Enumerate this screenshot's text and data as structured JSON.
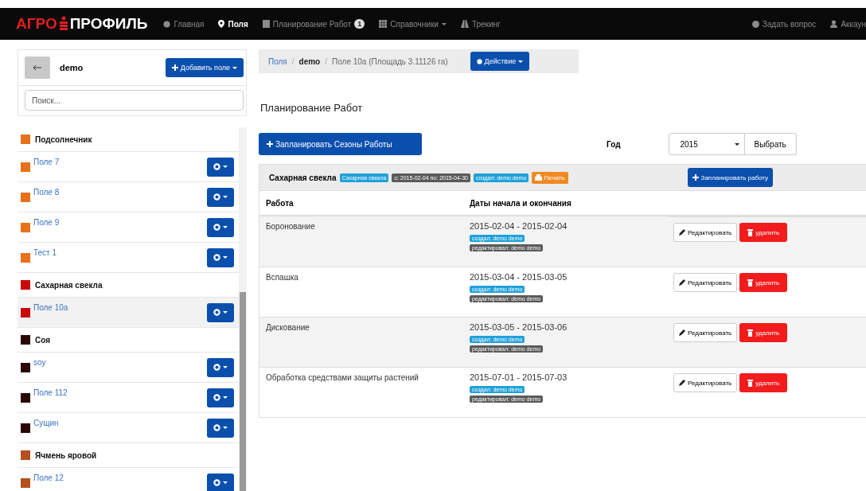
{
  "navbar": {
    "logo": {
      "part_1": "АГРО",
      "part_2": "ПРОФИЛЬ"
    },
    "items": [
      {
        "label": "Главная",
        "selected": false,
        "dropdown": false
      },
      {
        "label": "Поля",
        "selected": true,
        "dropdown": false
      },
      {
        "label": "Планирование Работ",
        "selected": false,
        "dropdown": false,
        "badge": "1"
      },
      {
        "label": "Справочники",
        "selected": false,
        "dropdown": true
      },
      {
        "label": "Трекинг",
        "selected": false,
        "dropdown": false
      }
    ],
    "right_items": [
      {
        "label": "Задать вопрос"
      },
      {
        "label": "Аккаун"
      }
    ]
  },
  "sidebar": {
    "farm": "demo",
    "add_button": "Добавить поле",
    "search": {
      "placeholder": "Поиск..."
    },
    "groups": [
      {
        "name": "Подсолнечник",
        "color": "#e8711c",
        "children": [
          {
            "name": "Поле 7",
            "selected": false
          },
          {
            "name": "Поле 8",
            "selected": false
          },
          {
            "name": "Поле 9",
            "selected": false
          },
          {
            "name": "Тест 1",
            "selected": false
          }
        ]
      },
      {
        "name": "Сахарная свекла",
        "color": "#c80a0a",
        "children": [
          {
            "name": "Поле 10а",
            "selected": true
          }
        ]
      },
      {
        "name": "Соя",
        "color": "#2a0808",
        "children": [
          {
            "name": "soy",
            "selected": false
          },
          {
            "name": "Поле 112",
            "selected": false
          },
          {
            "name": "Сущин",
            "selected": false
          }
        ]
      },
      {
        "name": "Ячмень яровой",
        "color": "#b4501e",
        "children": [
          {
            "name": "Поле 12",
            "selected": false
          }
        ]
      }
    ]
  },
  "breadcrumb": {
    "items": [
      {
        "label": "Поля",
        "kind": "link"
      },
      {
        "label": "demo",
        "kind": "bold"
      },
      {
        "label": "Поле 10а (Площадь 3.11126 га)",
        "kind": "plain"
      }
    ],
    "separator": "/",
    "action_button": "Действие"
  },
  "page_title": "Планирование Работ",
  "toolbar": {
    "plan_seasons_button": "Запланировать Сезоны Работы",
    "year_label": "Год",
    "year_value": "2015",
    "select_button": "Выбрать"
  },
  "panel": {
    "title": "Сахарная свекла",
    "labels": [
      {
        "text": "Сахарная свекла",
        "kind": "info"
      },
      {
        "text": "с: 2015-02-04 по: 2015-04-30",
        "kind": "default"
      },
      {
        "text": "создал: demo demo",
        "kind": "info"
      },
      {
        "text": "Печать",
        "kind": "warning"
      }
    ],
    "plan_button": "Запланировать работу",
    "table": {
      "columns": [
        "Работа",
        "Даты начала и окончания"
      ],
      "rows": [
        {
          "work": "Боронование",
          "dates": "2015-02-04 - 2015-02-04",
          "created": "создал: demo demo",
          "edited": "редактировал: demo demo",
          "edit": "Редактировать",
          "delete": "удалить"
        },
        {
          "work": "Вспашка",
          "dates": "2015-03-04 - 2015-03-05",
          "created": "создал: demo demo",
          "edited": "редактировал: demo demo",
          "edit": "Редактировать",
          "delete": "удалить"
        },
        {
          "work": "Дискование",
          "dates": "2015-03-05 - 2015-03-06",
          "created": "создал: demo demo",
          "edited": "редактировал: demo demo",
          "edit": "Редактировать",
          "delete": "удалить"
        },
        {
          "work": "Обработка средствами защиты растений",
          "dates": "2015-07-01 - 2015-07-03",
          "created": "создал: demo demo",
          "edited": "редактировал: demo demo",
          "edit": "Редактировать",
          "delete": "удалить"
        }
      ]
    }
  }
}
